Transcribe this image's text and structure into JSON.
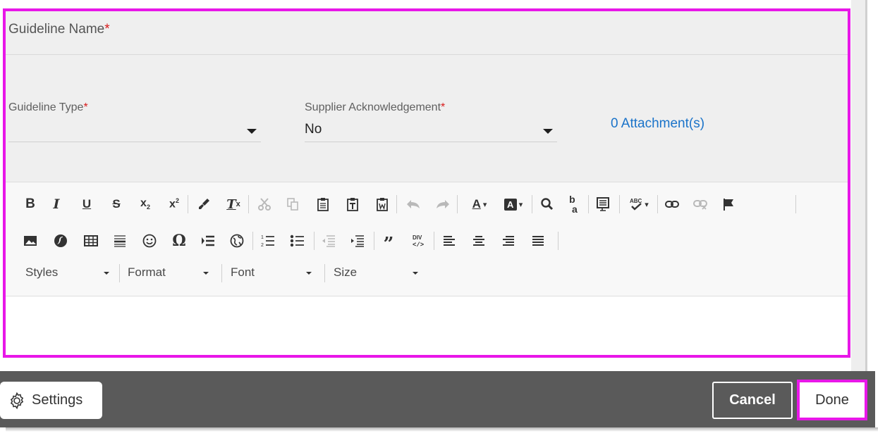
{
  "form": {
    "guideline_name_label": "Guideline Name",
    "guideline_type_label": "Guideline Type",
    "guideline_type_value": "",
    "supplier_ack_label": "Supplier Acknowledgement",
    "supplier_ack_value": "No",
    "required_marker": "*",
    "attachments_link": "0 Attachment(s)"
  },
  "editor": {
    "toolbar_row1": [
      "bold-icon",
      "italic-icon",
      "underline-icon",
      "strikethrough-icon",
      "subscript-icon",
      "superscript-icon",
      "copy-formatting-icon",
      "remove-format-icon",
      "cut-icon",
      "copy-icon",
      "paste-icon",
      "paste-text-icon",
      "paste-word-icon",
      "undo-icon",
      "redo-icon",
      "text-color-icon",
      "background-color-icon",
      "find-icon",
      "replace-icon",
      "select-all-icon",
      "spellcheck-icon",
      "link-icon",
      "unlink-icon",
      "anchor-icon"
    ],
    "toolbar_row2": [
      "image-icon",
      "flash-icon",
      "table-icon",
      "horizontal-line-icon",
      "smiley-icon",
      "special-char-icon",
      "page-break-icon",
      "iframe-icon",
      "numbered-list-icon",
      "bulleted-list-icon",
      "outdent-icon",
      "indent-icon",
      "blockquote-icon",
      "create-div-icon",
      "align-left-icon",
      "align-center-icon",
      "align-right-icon",
      "justify-icon"
    ],
    "styles_label": "Styles",
    "format_label": "Format",
    "font_label": "Font",
    "size_label": "Size",
    "body_text": ""
  },
  "footer": {
    "settings_label": "Settings",
    "cancel_label": "Cancel",
    "done_label": "Done"
  },
  "colors": {
    "highlight": "#e817e8",
    "footer_bg": "#5a5a5a",
    "link": "#1a73c9",
    "required": "#d81b1b"
  }
}
